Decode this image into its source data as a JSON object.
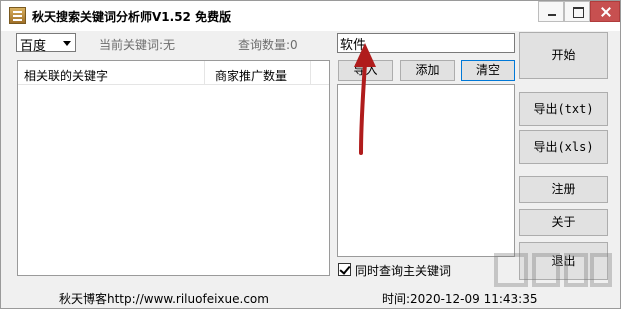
{
  "window": {
    "title": "秋天搜索关键词分析师V1.52 免费版"
  },
  "toolbar": {
    "engine_selected": "百度",
    "current_keyword_label": "当前关键词:无",
    "query_count_label": "查询数量:0"
  },
  "table": {
    "columns": [
      "相关联的关键字",
      "商家推广数量"
    ]
  },
  "keyword_input": {
    "value": "软件"
  },
  "actions": {
    "import_label": "导入",
    "add_label": "添加",
    "clear_label": "清空"
  },
  "options": {
    "query_main_keyword_label": "同时查询主关键词",
    "query_main_keyword_checked": true
  },
  "side_buttons": {
    "start": "开始",
    "export_txt": "导出(txt)",
    "export_xls": "导出(xls)",
    "register": "注册",
    "about": "关于",
    "exit": "退出"
  },
  "footer": {
    "blog": "秋天博客http://www.riluofeixue.com",
    "time": "时间:2020-12-09 11:43:35"
  },
  "colors": {
    "annotation_arrow": "#b01c1c",
    "focus_border": "#0078d7",
    "close_button": "#c75050"
  }
}
